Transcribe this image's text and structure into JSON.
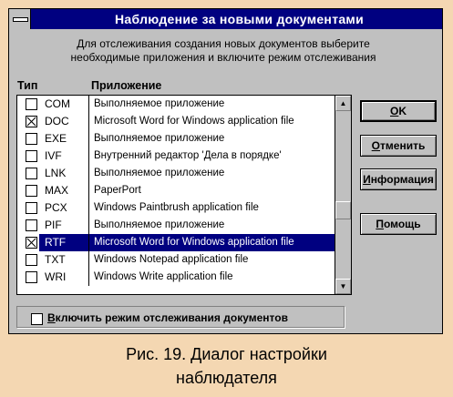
{
  "window": {
    "title": "Наблюдение за новыми документами"
  },
  "intro": {
    "line1": "Для отслеживания создания новых документов выберите",
    "line2": "необходимые приложения и включите режим отслеживания"
  },
  "columns": {
    "type": "Тип",
    "app": "Приложение"
  },
  "rows": [
    {
      "ext": "COM",
      "app": "Выполняемое приложение",
      "checked": false,
      "selected": false
    },
    {
      "ext": "DOC",
      "app": "Microsoft Word for Windows application file",
      "checked": true,
      "selected": false
    },
    {
      "ext": "EXE",
      "app": "Выполняемое приложение",
      "checked": false,
      "selected": false
    },
    {
      "ext": "IVF",
      "app": "Внутренний редактор 'Дела в порядке'",
      "checked": false,
      "selected": false
    },
    {
      "ext": "LNK",
      "app": "Выполняемое приложение",
      "checked": false,
      "selected": false
    },
    {
      "ext": "MAX",
      "app": "PaperPort",
      "checked": false,
      "selected": false
    },
    {
      "ext": "PCX",
      "app": "Windows Paintbrush application file",
      "checked": false,
      "selected": false
    },
    {
      "ext": "PIF",
      "app": "Выполняемое приложение",
      "checked": false,
      "selected": false
    },
    {
      "ext": "RTF",
      "app": "Microsoft Word for Windows application file",
      "checked": true,
      "selected": true
    },
    {
      "ext": "TXT",
      "app": "Windows Notepad application file",
      "checked": false,
      "selected": false
    },
    {
      "ext": "WRI",
      "app": "Windows Write application file",
      "checked": false,
      "selected": false
    }
  ],
  "buttons": {
    "ok": {
      "hot": "O",
      "rest": "K"
    },
    "cancel": {
      "hot": "О",
      "rest": "тменить"
    },
    "info": {
      "hot": "И",
      "rest": "нформация"
    },
    "help": {
      "hot": "П",
      "rest": "омощь"
    }
  },
  "monitor": {
    "hot": "В",
    "rest": "ключить режим отслеживания документов",
    "checked": false
  },
  "caption": {
    "line1": "Рис. 19. Диалог настройки",
    "line2": "наблюдателя"
  }
}
